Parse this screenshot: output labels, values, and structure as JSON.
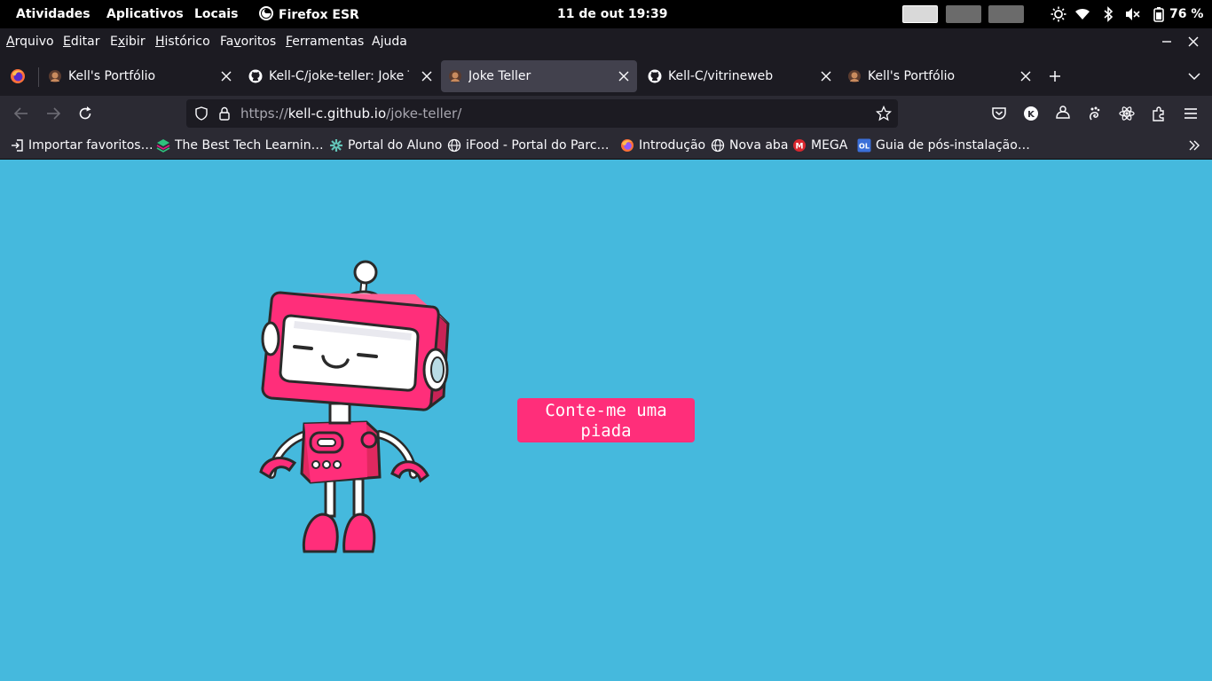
{
  "gnome_bar": {
    "activities": "Atividades",
    "apps": "Aplicativos",
    "places": "Locais",
    "focused_app": "Firefox ESR",
    "datetime": "11 de out  19:39",
    "battery": "76 %"
  },
  "menubar": {
    "items": [
      {
        "label": "Arquivo",
        "accel": "A"
      },
      {
        "label": "Editar",
        "accel": "E"
      },
      {
        "label": "Exibir",
        "accel": "x"
      },
      {
        "label": "Histórico",
        "accel": "H"
      },
      {
        "label": "Favoritos",
        "accel": "v"
      },
      {
        "label": "Ferramentas",
        "accel": "F"
      },
      {
        "label": "Ajuda",
        "accel": "j"
      }
    ]
  },
  "tabs": [
    {
      "title": "Kell's Portfólio",
      "active": false,
      "icon": "portfolio-favicon"
    },
    {
      "title": "Kell-C/joke-teller: Joke Teller",
      "active": false,
      "icon": "github-icon"
    },
    {
      "title": "Joke Teller",
      "active": true,
      "icon": "portfolio-favicon"
    },
    {
      "title": "Kell-C/vitrineweb",
      "active": false,
      "icon": "github-icon"
    },
    {
      "title": "Kell's Portfólio",
      "active": false,
      "icon": "portfolio-favicon"
    }
  ],
  "urlbar": {
    "prefix": "https://",
    "domain": "kell-c.github.io",
    "path": "/joke-teller/"
  },
  "bookmarks": [
    {
      "label": "Importar favoritos…",
      "icon": "import-icon"
    },
    {
      "label": "The Best Tech Learnin…",
      "icon": "layers-icon"
    },
    {
      "label": "Portal do Aluno",
      "icon": "gear-icon"
    },
    {
      "label": "iFood - Portal do Parc…",
      "icon": "globe-icon"
    },
    {
      "label": "Introdução",
      "icon": "firefox-icon"
    },
    {
      "label": "Nova aba",
      "icon": "globe-icon"
    },
    {
      "label": "MEGA",
      "icon": "mega-icon"
    },
    {
      "label": "Guia de pós-instalação…",
      "icon": "ol-icon"
    }
  ],
  "page": {
    "button_label": "Conte-me uma piada",
    "button_color": "#ff2e7a",
    "background_color": "#45b9dd"
  }
}
